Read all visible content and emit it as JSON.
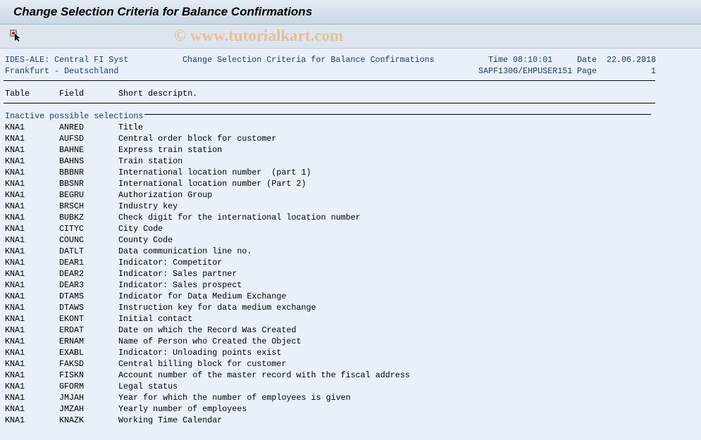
{
  "window": {
    "title": "Change Selection Criteria for Balance Confirmations",
    "watermark": "© www.tutorialkart.com",
    "toolbar_icon": "select-cursor-icon"
  },
  "header": {
    "system": "IDES-ALE: Central FI Syst",
    "location": "Frankfurt - Deutschland",
    "report_title": "Change Selection Criteria for Balance Confirmations",
    "time_label": "Time",
    "time": "08:10:01",
    "date_label": "Date",
    "date": "22.06.2018",
    "program": "SAPF130G/EHPUSER151",
    "page_label": "Page",
    "page": "1"
  },
  "columns": [
    "Table",
    "Field",
    "Short descriptn."
  ],
  "section_label": "Inactive possible selections",
  "rows": [
    [
      "KNA1",
      "ANRED",
      "Title"
    ],
    [
      "KNA1",
      "AUFSD",
      "Central order block for customer"
    ],
    [
      "KNA1",
      "BAHNE",
      "Express train station"
    ],
    [
      "KNA1",
      "BAHNS",
      "Train station"
    ],
    [
      "KNA1",
      "BBBNR",
      "International location number  (part 1)"
    ],
    [
      "KNA1",
      "BBSNR",
      "International location number (Part 2)"
    ],
    [
      "KNA1",
      "BEGRU",
      "Authorization Group"
    ],
    [
      "KNA1",
      "BRSCH",
      "Industry key"
    ],
    [
      "KNA1",
      "BUBKZ",
      "Check digit for the international location number"
    ],
    [
      "KNA1",
      "CITYC",
      "City Code"
    ],
    [
      "KNA1",
      "COUNC",
      "County Code"
    ],
    [
      "KNA1",
      "DATLT",
      "Data communication line no."
    ],
    [
      "KNA1",
      "DEAR1",
      "Indicator: Competitor"
    ],
    [
      "KNA1",
      "DEAR2",
      "Indicator: Sales partner"
    ],
    [
      "KNA1",
      "DEAR3",
      "Indicator: Sales prospect"
    ],
    [
      "KNA1",
      "DTAMS",
      "Indicator for Data Medium Exchange"
    ],
    [
      "KNA1",
      "DTAWS",
      "Instruction key for data medium exchange"
    ],
    [
      "KNA1",
      "EKONT",
      "Initial contact"
    ],
    [
      "KNA1",
      "ERDAT",
      "Date on which the Record Was Created"
    ],
    [
      "KNA1",
      "ERNAM",
      "Name of Person who Created the Object"
    ],
    [
      "KNA1",
      "EXABL",
      "Indicator: Unloading points exist"
    ],
    [
      "KNA1",
      "FAKSD",
      "Central billing block for customer"
    ],
    [
      "KNA1",
      "FISKN",
      "Account number of the master record with the fiscal address"
    ],
    [
      "KNA1",
      "GFORM",
      "Legal status"
    ],
    [
      "KNA1",
      "JMJAH",
      "Year for which the number of employees is given"
    ],
    [
      "KNA1",
      "JMZAH",
      "Yearly number of employees"
    ],
    [
      "KNA1",
      "KNAZK",
      "Working Time Calendar"
    ]
  ]
}
